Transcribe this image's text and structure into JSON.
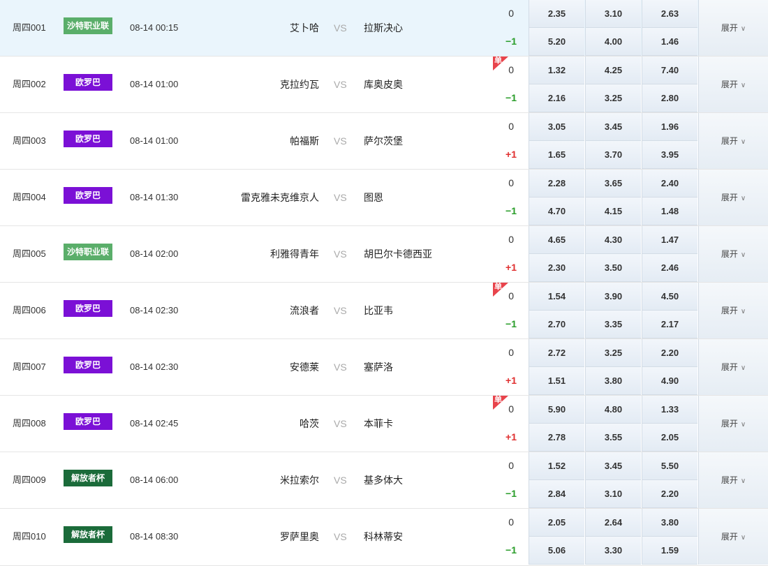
{
  "colors": {
    "saudi": "#5aae6a",
    "europa": "#7b10d6",
    "liberation": "#1b6b3a",
    "highlight": "#eaf5fc"
  },
  "expand_label": "展开",
  "single_label": "单",
  "matches": [
    {
      "num": "周四001",
      "league": "沙特职业联",
      "lc": "#5aae6a",
      "time": "08-14 00:15",
      "home": "艾卜哈",
      "vs": "VS",
      "away": "拉斯决心",
      "hc0": "0",
      "hc1": "−1",
      "hcType": "neg",
      "single": false,
      "highlight": true,
      "odds": [
        [
          "2.35",
          "3.10",
          "2.63"
        ],
        [
          "5.20",
          "4.00",
          "1.46"
        ]
      ]
    },
    {
      "num": "周四002",
      "league": "欧罗巴",
      "lc": "#7b10d6",
      "time": "08-14 01:00",
      "home": "克拉约瓦",
      "vs": "VS",
      "away": "库奥皮奥",
      "hc0": "0",
      "hc1": "−1",
      "hcType": "neg",
      "single": true,
      "highlight": false,
      "odds": [
        [
          "1.32",
          "4.25",
          "7.40"
        ],
        [
          "2.16",
          "3.25",
          "2.80"
        ]
      ]
    },
    {
      "num": "周四003",
      "league": "欧罗巴",
      "lc": "#7b10d6",
      "time": "08-14 01:00",
      "home": "帕福斯",
      "vs": "VS",
      "away": "萨尔茨堡",
      "hc0": "0",
      "hc1": "+1",
      "hcType": "pos",
      "single": false,
      "highlight": false,
      "odds": [
        [
          "3.05",
          "3.45",
          "1.96"
        ],
        [
          "1.65",
          "3.70",
          "3.95"
        ]
      ]
    },
    {
      "num": "周四004",
      "league": "欧罗巴",
      "lc": "#7b10d6",
      "time": "08-14 01:30",
      "home": "雷克雅未克维京人",
      "vs": "VS",
      "away": "图恩",
      "hc0": "0",
      "hc1": "−1",
      "hcType": "neg",
      "single": false,
      "highlight": false,
      "odds": [
        [
          "2.28",
          "3.65",
          "2.40"
        ],
        [
          "4.70",
          "4.15",
          "1.48"
        ]
      ]
    },
    {
      "num": "周四005",
      "league": "沙特职业联",
      "lc": "#5aae6a",
      "time": "08-14 02:00",
      "home": "利雅得青年",
      "vs": "VS",
      "away": "胡巴尔卡德西亚",
      "hc0": "0",
      "hc1": "+1",
      "hcType": "pos",
      "single": false,
      "highlight": false,
      "odds": [
        [
          "4.65",
          "4.30",
          "1.47"
        ],
        [
          "2.30",
          "3.50",
          "2.46"
        ]
      ]
    },
    {
      "num": "周四006",
      "league": "欧罗巴",
      "lc": "#7b10d6",
      "time": "08-14 02:30",
      "home": "流浪者",
      "vs": "VS",
      "away": "比亚韦",
      "hc0": "0",
      "hc1": "−1",
      "hcType": "neg",
      "single": true,
      "highlight": false,
      "odds": [
        [
          "1.54",
          "3.90",
          "4.50"
        ],
        [
          "2.70",
          "3.35",
          "2.17"
        ]
      ]
    },
    {
      "num": "周四007",
      "league": "欧罗巴",
      "lc": "#7b10d6",
      "time": "08-14 02:30",
      "home": "安德莱",
      "vs": "VS",
      "away": "塞萨洛",
      "hc0": "0",
      "hc1": "+1",
      "hcType": "pos",
      "single": false,
      "highlight": false,
      "odds": [
        [
          "2.72",
          "3.25",
          "2.20"
        ],
        [
          "1.51",
          "3.80",
          "4.90"
        ]
      ]
    },
    {
      "num": "周四008",
      "league": "欧罗巴",
      "lc": "#7b10d6",
      "time": "08-14 02:45",
      "home": "哈茨",
      "vs": "VS",
      "away": "本菲卡",
      "hc0": "0",
      "hc1": "+1",
      "hcType": "pos",
      "single": true,
      "highlight": false,
      "odds": [
        [
          "5.90",
          "4.80",
          "1.33"
        ],
        [
          "2.78",
          "3.55",
          "2.05"
        ]
      ]
    },
    {
      "num": "周四009",
      "league": "解放者杯",
      "lc": "#1b6b3a",
      "time": "08-14 06:00",
      "home": "米拉索尔",
      "vs": "VS",
      "away": "基多体大",
      "hc0": "0",
      "hc1": "−1",
      "hcType": "neg",
      "single": false,
      "highlight": false,
      "odds": [
        [
          "1.52",
          "3.45",
          "5.50"
        ],
        [
          "2.84",
          "3.10",
          "2.20"
        ]
      ]
    },
    {
      "num": "周四010",
      "league": "解放者杯",
      "lc": "#1b6b3a",
      "time": "08-14 08:30",
      "home": "罗萨里奥",
      "vs": "VS",
      "away": "科林蒂安",
      "hc0": "0",
      "hc1": "−1",
      "hcType": "neg",
      "single": false,
      "highlight": false,
      "odds": [
        [
          "2.05",
          "2.64",
          "3.80"
        ],
        [
          "5.06",
          "3.30",
          "1.59"
        ]
      ]
    }
  ]
}
